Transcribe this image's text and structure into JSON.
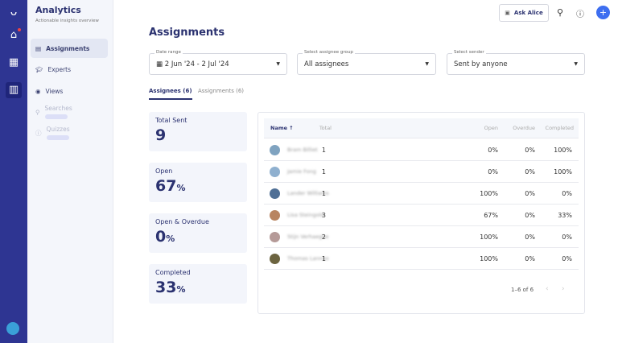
{
  "sidebar": {
    "title": "Analytics",
    "subtitle": "Actionable insights overview",
    "items": [
      {
        "label": "Assignments",
        "icon": "clipboard-icon"
      },
      {
        "label": "Experts",
        "icon": "graduation-cap-icon"
      },
      {
        "label": "Views",
        "icon": "eye-icon"
      },
      {
        "label": "Searches",
        "icon": "search-icon"
      },
      {
        "label": "Quizzes",
        "icon": "info-icon"
      }
    ]
  },
  "topbar": {
    "ask_label": "Ask Alice"
  },
  "page": {
    "title": "Assignments"
  },
  "filters": [
    {
      "label": "Date range",
      "value": "2 Jun '24 - 2 Jul '24"
    },
    {
      "label": "Select assignee group",
      "value": "All assignees"
    },
    {
      "label": "Select sender",
      "value": "Sent by anyone"
    }
  ],
  "tabs": [
    {
      "label": "Assignees (6)",
      "active": true
    },
    {
      "label": "Assignments (6)",
      "active": false
    }
  ],
  "stats": [
    {
      "label": "Total Sent",
      "value": "9",
      "unit": ""
    },
    {
      "label": "Open",
      "value": "67",
      "unit": "%"
    },
    {
      "label": "Open & Overdue",
      "value": "0",
      "unit": "%"
    },
    {
      "label": "Completed",
      "value": "33",
      "unit": "%"
    }
  ],
  "table": {
    "columns": [
      "Name ↑",
      "Total",
      "Open",
      "Overdue",
      "Completed"
    ],
    "rows": [
      {
        "name": "Bram Billiet",
        "total": "1",
        "open": "0%",
        "overdue": "0%",
        "completed": "100%",
        "avatar": "#7fa3c0"
      },
      {
        "name": "Jamie Fong",
        "total": "1",
        "open": "0%",
        "overdue": "0%",
        "completed": "100%",
        "avatar": "#8fb0cf"
      },
      {
        "name": "Lander Williams",
        "total": "1",
        "open": "100%",
        "overdue": "0%",
        "completed": "0%",
        "avatar": "#4f6f95"
      },
      {
        "name": "Lisa Steingold",
        "total": "3",
        "open": "67%",
        "overdue": "0%",
        "completed": "33%",
        "avatar": "#b88461"
      },
      {
        "name": "Stijn Verhaeghe",
        "total": "2",
        "open": "100%",
        "overdue": "0%",
        "completed": "0%",
        "avatar": "#b59a98"
      },
      {
        "name": "Thomas Lannoo",
        "total": "1",
        "open": "100%",
        "overdue": "0%",
        "completed": "0%",
        "avatar": "#6c6440"
      }
    ]
  },
  "pagination": {
    "range": "1–6 of 6"
  },
  "colors": {
    "rail": "#2e3592",
    "accent": "#2b3270",
    "primary": "#3d6ef0"
  }
}
